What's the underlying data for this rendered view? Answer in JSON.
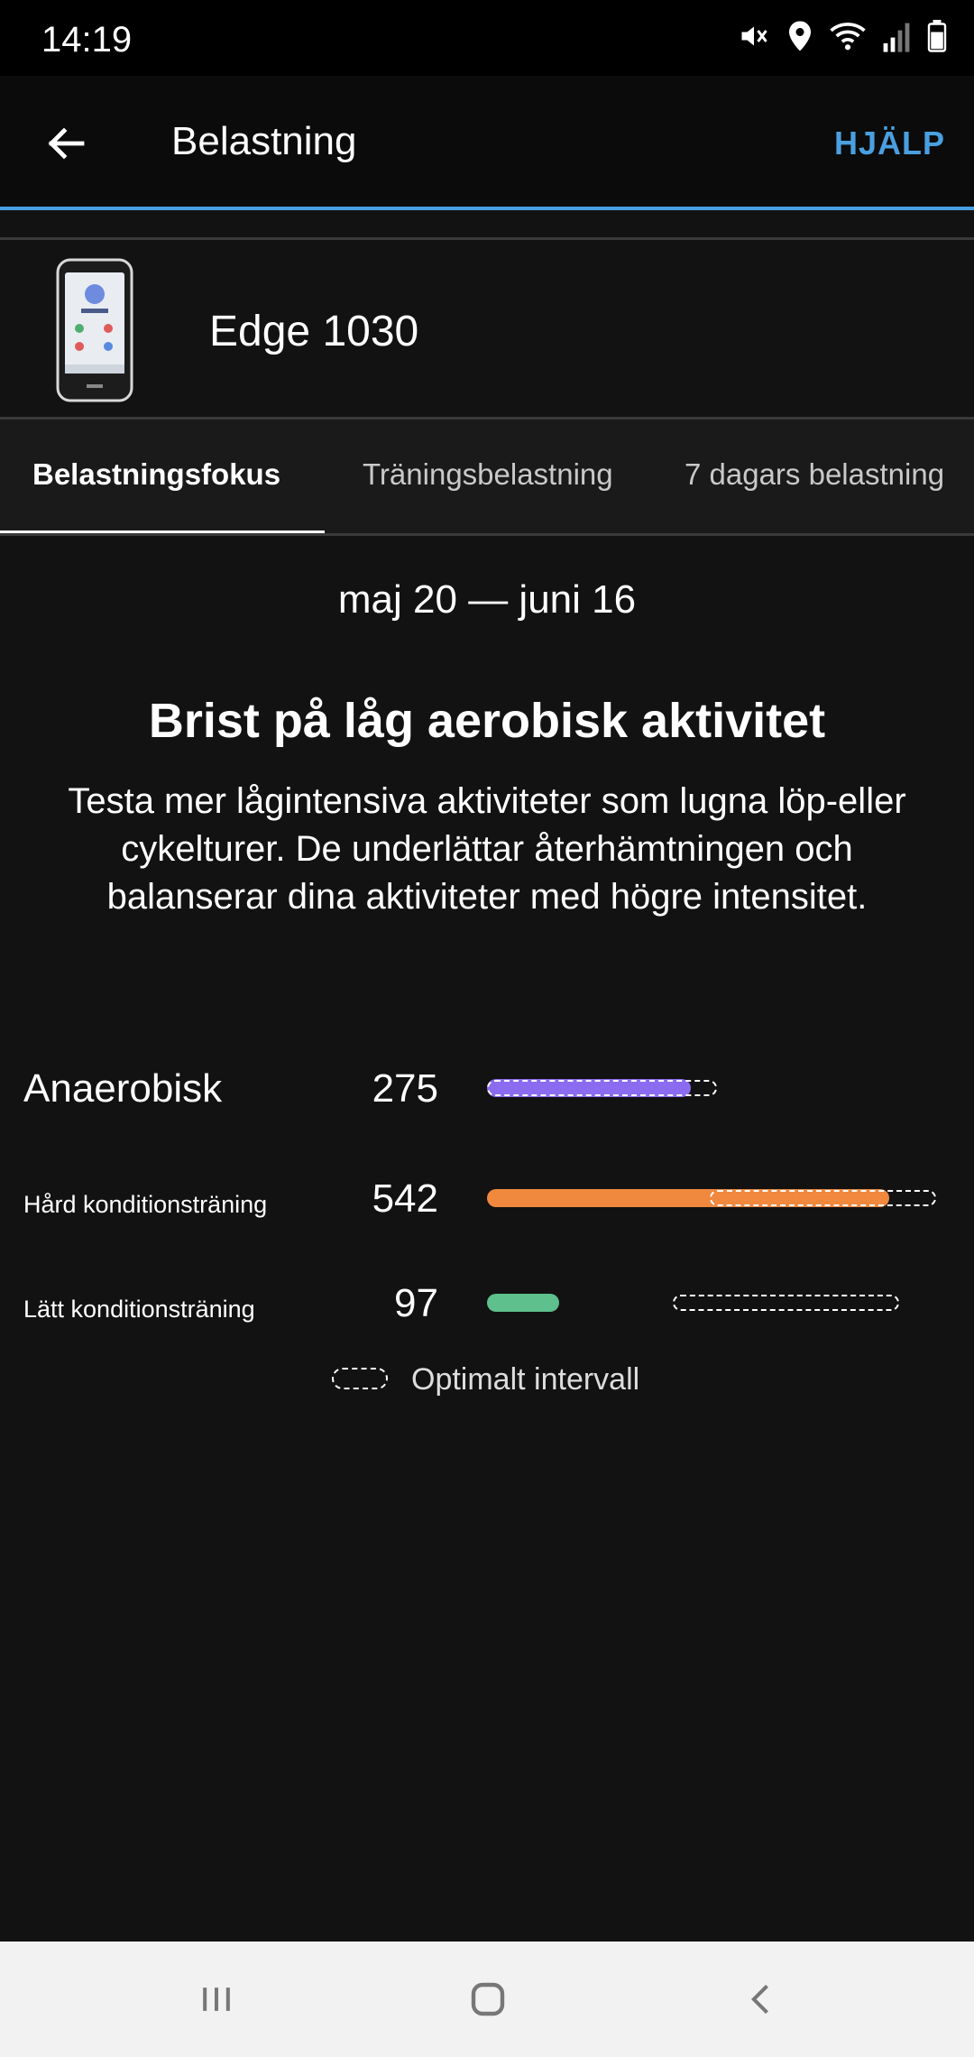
{
  "status": {
    "time": "14:19",
    "icons": [
      "mute-icon",
      "location-icon",
      "wifi-icon",
      "signal-icon",
      "battery-icon"
    ]
  },
  "header": {
    "title": "Belastning",
    "help_label": "HJÄLP",
    "back_icon": "arrow-left-icon",
    "accent_color": "#4a9fe0"
  },
  "device": {
    "name": "Edge 1030",
    "image_icon": "device-edge-icon"
  },
  "tabs": [
    {
      "label": "Belastningsfokus",
      "active": true
    },
    {
      "label": "Träningsbelastning",
      "active": false
    },
    {
      "label": "7 dagars belastning",
      "active": false
    }
  ],
  "content": {
    "date_range": "maj 20 — juni 16",
    "headline": "Brist på låg aerobisk aktivitet",
    "description": "Testa mer lågintensiva aktiviteter som lugna löp-eller cykelturer. De underlättar återhämtningen och balanserar dina aktiviteter med högre intensitet."
  },
  "load_focus": {
    "scale_max": 620,
    "bars": [
      {
        "label": "Anaerobisk",
        "value": 275,
        "color": "#8b6cf0",
        "optimal_range": [
          0,
          310
        ]
      },
      {
        "label": "Hård konditionsträning",
        "value": 542,
        "color": "#f0883e",
        "optimal_range": [
          300,
          605
        ]
      },
      {
        "label": "Lätt konditionsträning",
        "value": 97,
        "color": "#5dc08d",
        "optimal_range": [
          250,
          555
        ]
      }
    ],
    "legend_label": "Optimalt intervall"
  },
  "navbar": {
    "icons": [
      "recent-apps-icon",
      "home-icon",
      "back-icon"
    ]
  }
}
